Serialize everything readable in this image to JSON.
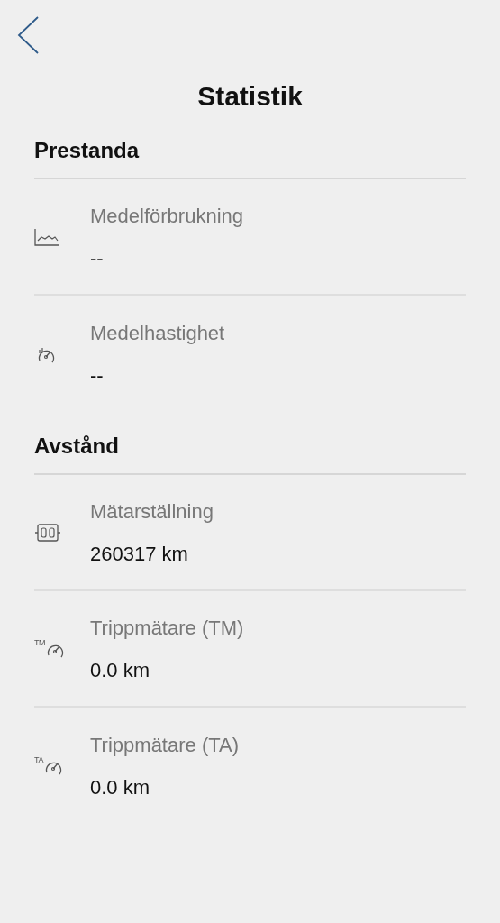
{
  "title": "Statistik",
  "sections": [
    {
      "heading": "Prestanda",
      "rows": [
        {
          "kind": "chart",
          "label": "Medelförbrukning",
          "value": "--"
        },
        {
          "kind": "speed",
          "label": "Medelhastighet",
          "value": "--"
        }
      ]
    },
    {
      "heading": "Avstånd",
      "rows": [
        {
          "kind": "odometer",
          "label": "Mätarställning",
          "value": "260317 km"
        },
        {
          "kind": "trip",
          "icon_label": "TM",
          "label": "Trippmätare (TM)",
          "value": "0.0 km"
        },
        {
          "kind": "trip",
          "icon_label": "TA",
          "label": "Trippmätare (TA)",
          "value": "0.0 km"
        }
      ]
    }
  ]
}
